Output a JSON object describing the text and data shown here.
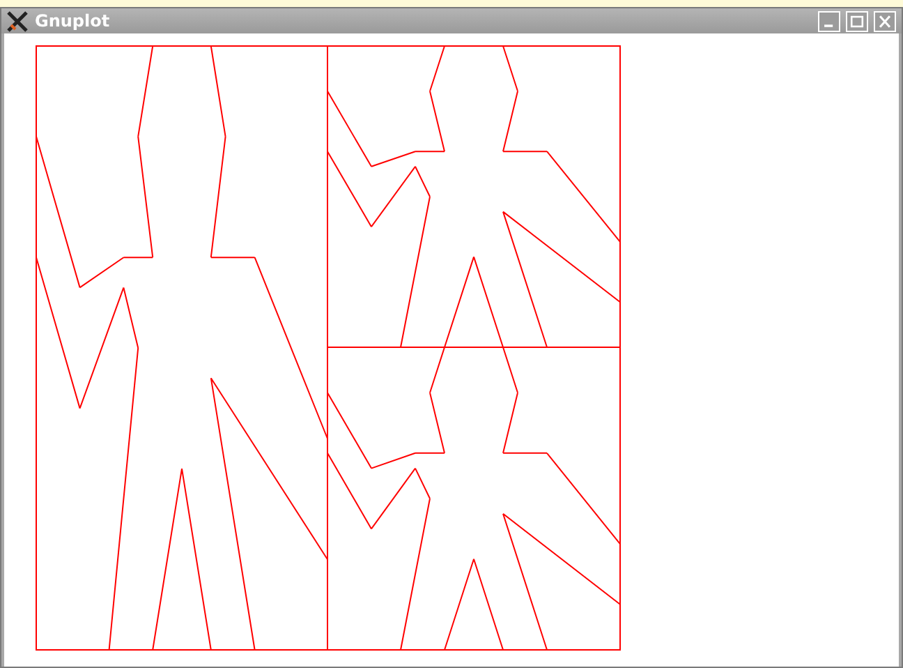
{
  "window": {
    "title": "Gnuplot"
  }
}
